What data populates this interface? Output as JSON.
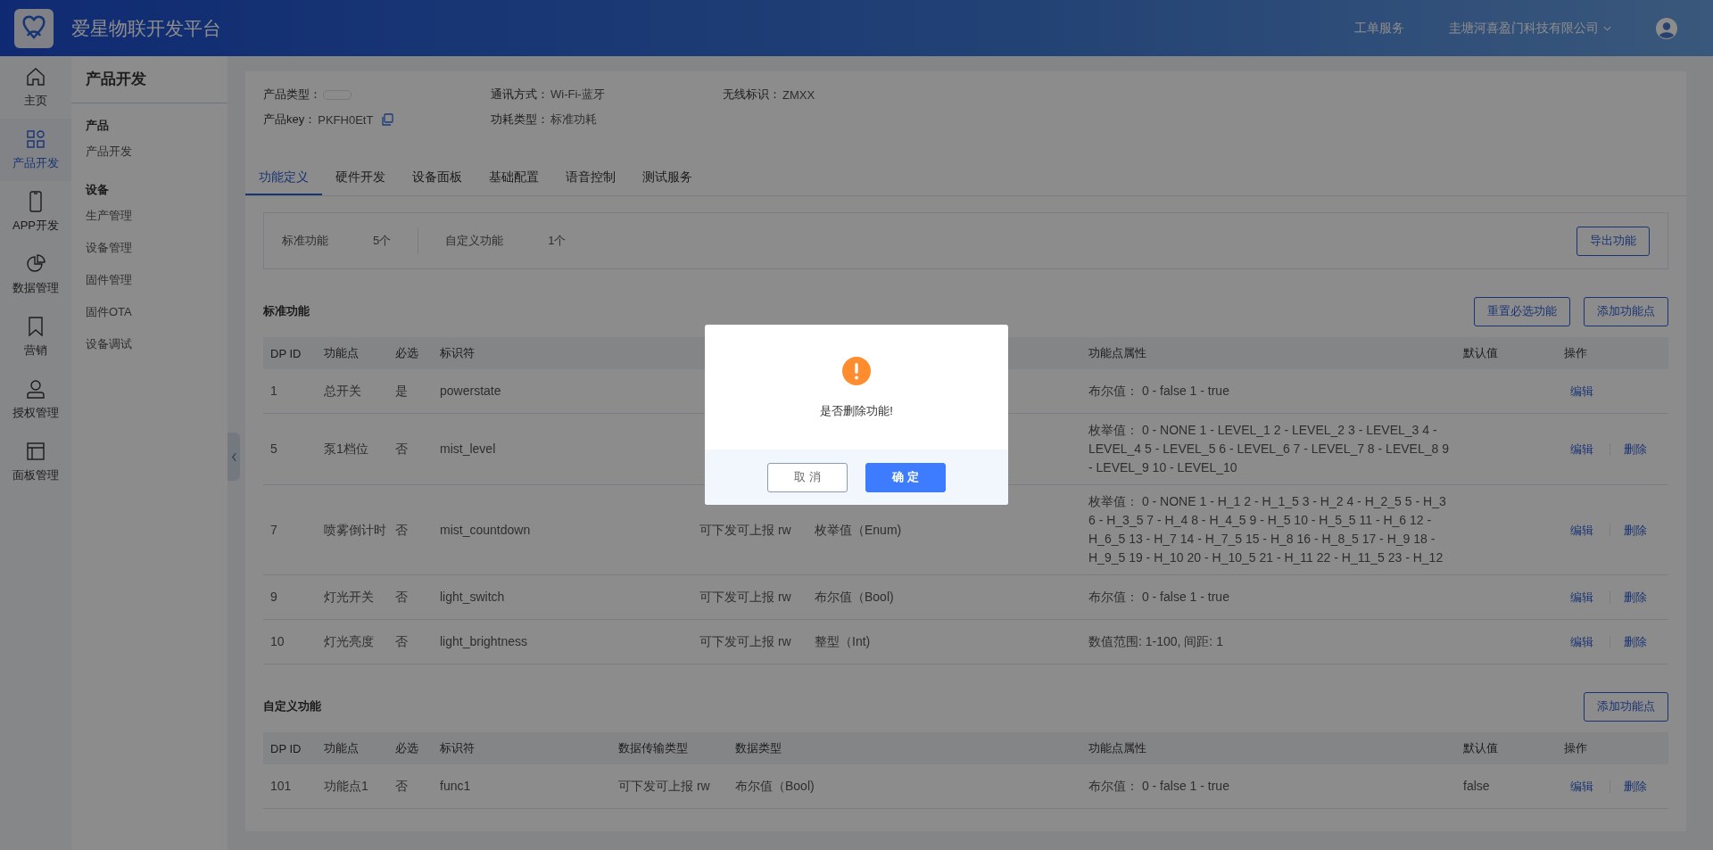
{
  "header": {
    "title": "爱星物联开发平台",
    "links": [
      {
        "label": "工单服务",
        "dropdown": false
      },
      {
        "label": "圭塘河喜盈门科技有限公司",
        "dropdown": true
      }
    ]
  },
  "rail": [
    {
      "label": "主页",
      "selected": false
    },
    {
      "label": "产品开发",
      "selected": true
    },
    {
      "label": "APP开发",
      "selected": false
    },
    {
      "label": "数据管理",
      "selected": false
    },
    {
      "label": "营销",
      "selected": false
    },
    {
      "label": "授权管理",
      "selected": false
    },
    {
      "label": "面板管理",
      "selected": false
    }
  ],
  "submenu": {
    "title": "产品开发",
    "groups": [
      {
        "label": "产品",
        "items": [
          "产品开发"
        ]
      },
      {
        "label": "设备",
        "items": [
          "生产管理",
          "设备管理",
          "固件管理",
          "固件OTA",
          "设备调试"
        ]
      }
    ]
  },
  "info": [
    [
      {
        "label": "产品类型：",
        "redacted": true
      },
      {
        "label": "通讯方式：",
        "value": "Wi-Fi-蓝牙"
      },
      {
        "label": "无线标识：",
        "value": "ZMXX"
      }
    ],
    [
      {
        "label": "产品key：",
        "value": "PKFH0EtT",
        "copyable": true
      },
      {
        "label": "功耗类型：",
        "value": "标准功耗"
      }
    ]
  ],
  "tabs": [
    {
      "label": "功能定义",
      "selected": true
    },
    {
      "label": "硬件开发",
      "selected": false
    },
    {
      "label": "设备面板",
      "selected": false
    },
    {
      "label": "基础配置",
      "selected": false
    },
    {
      "label": "语音控制",
      "selected": false
    },
    {
      "label": "测试服务",
      "selected": false
    }
  ],
  "summary": {
    "stats": [
      {
        "label": "标准功能",
        "count": "5个"
      },
      {
        "label": "自定义功能",
        "count": "1个"
      }
    ],
    "button": "导出功能"
  },
  "sections": [
    {
      "title": "标准功能",
      "buttons": [
        "重置必选功能",
        "添加功能点"
      ],
      "columns": [
        {
          "label": "DP ID"
        },
        {
          "label": "功能点"
        },
        {
          "label": "必选"
        },
        {
          "label": "标识符"
        },
        {},
        {},
        {
          "label": "功能点属性"
        },
        {
          "label": "默认值"
        },
        {
          "label": "操作"
        }
      ],
      "rows": [
        {
          "cells": [
            "1",
            "总开关",
            "是",
            "powerstate",
            null,
            null,
            "布尔值： 0 - false 1 - true",
            null
          ],
          "actions": [
            "编辑"
          ]
        },
        {
          "cells": [
            "5",
            "泵1档位",
            "否",
            "mist_level",
            null,
            null,
            "枚举值： 0 - NONE 1 - LEVEL_1 2 - LEVEL_2 3 - LEVEL_3 4 - LEVEL_4 5 - LEVEL_5 6 - LEVEL_6 7 - LEVEL_7 8 - LEVEL_8 9 - LEVEL_9 10 - LEVEL_10",
            null
          ],
          "actions": [
            "编辑",
            "删除"
          ]
        },
        {
          "cells": [
            "7",
            "喷雾倒计时",
            "否",
            "mist_countdown",
            "可下发可上报 rw",
            "枚举值（Enum)",
            "枚举值： 0 - NONE 1 - H_1 2 - H_1_5 3 - H_2 4 - H_2_5 5 - H_3 6 - H_3_5 7 - H_4 8 - H_4_5 9 - H_5 10 - H_5_5 11 - H_6 12 - H_6_5 13 - H_7 14 - H_7_5 15 - H_8 16 - H_8_5 17 - H_9 18 - H_9_5 19 - H_10 20 - H_10_5 21 - H_11 22 - H_11_5 23 - H_12",
            null
          ],
          "actions": [
            "编辑",
            "删除"
          ]
        },
        {
          "cells": [
            "9",
            "灯光开关",
            "否",
            "light_switch",
            "可下发可上报 rw",
            "布尔值（Bool)",
            "布尔值： 0 - false 1 - true",
            null
          ],
          "actions": [
            "编辑",
            "删除"
          ]
        },
        {
          "cells": [
            "10",
            "灯光亮度",
            "否",
            "light_brightness",
            "可下发可上报 rw",
            "整型（Int)",
            "数值范围: 1-100, 间距: 1",
            null
          ],
          "actions": [
            "编辑",
            "删除"
          ]
        }
      ]
    },
    {
      "title": "自定义功能",
      "buttons": [
        "添加功能点"
      ],
      "columns": [
        {
          "label": "DP ID"
        },
        {
          "label": "功能点"
        },
        {
          "label": "必选"
        },
        {
          "label": "标识符"
        },
        {
          "label": "数据传输类型"
        },
        {
          "label": "数据类型"
        },
        {
          "label": "功能点属性"
        },
        {
          "label": "默认值"
        },
        {
          "label": "操作"
        }
      ],
      "rows": [
        {
          "cells": [
            "101",
            "功能点1",
            "否",
            "func1",
            "可下发可上报 rw",
            "布尔值（Bool)",
            "布尔值： 0 - false 1 - true",
            "false"
          ],
          "actions": [
            "编辑",
            "删除"
          ]
        }
      ]
    }
  ],
  "dialog": {
    "message": "是否删除功能!",
    "buttons": [
      {
        "label": "取 消",
        "kind": "secondary"
      },
      {
        "label": "确 定",
        "kind": "primary"
      }
    ]
  }
}
